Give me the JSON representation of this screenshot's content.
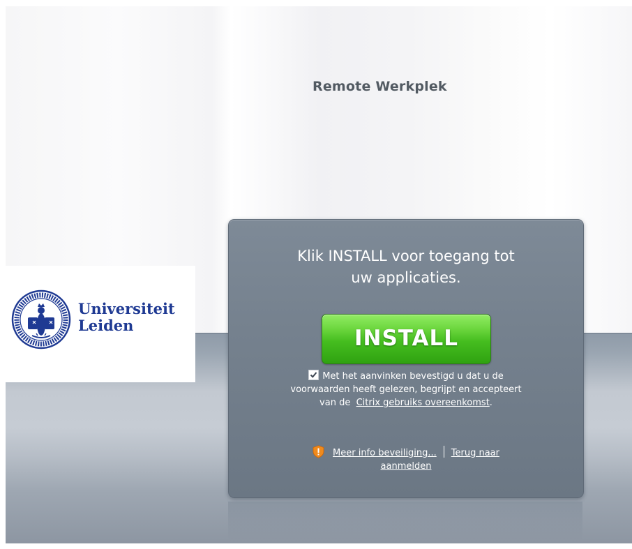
{
  "header": {
    "title": "Remote Werkplek"
  },
  "logo": {
    "line1": "Universiteit",
    "line2": "Leiden"
  },
  "install_panel": {
    "headline_line1": "Klik INSTALL voor toegang tot",
    "headline_line2": "uw applicaties.",
    "install_button_label": "INSTALL",
    "checkbox_checked": true,
    "consent_part1": "Met het aanvinken bevestigd u dat u de",
    "consent_part2": "voorwaarden heeft gelezen, begrijpt en accepteert",
    "consent_prefix": "van de",
    "consent_link": "Citrix gebruiks overeenkomst",
    "consent_suffix": ".",
    "security_link": "Meer info beveiliging...",
    "back_link_line1": "Terug naar",
    "back_link_line2": "aanmelden"
  },
  "colors": {
    "install_button": "#45bd1f",
    "panel": "#75818e",
    "logo_blue": "#1f3a93",
    "shield_orange": "#f08a1c"
  },
  "icons": {
    "seal": "university-seal-icon",
    "shield": "shield-warning-icon",
    "checkbox": "check-icon"
  }
}
